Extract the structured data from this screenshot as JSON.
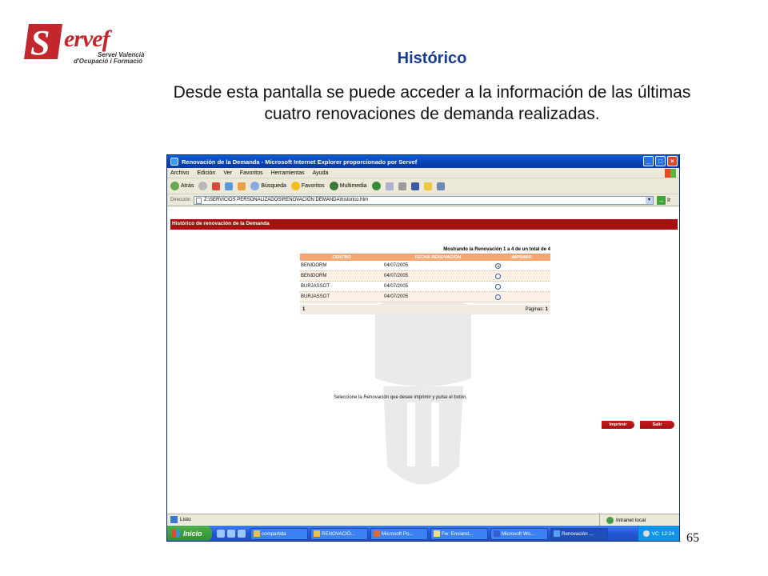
{
  "logo": {
    "name": "ervef",
    "line1": "Servei Valencià",
    "line2": "d'Ocupació i Formació"
  },
  "slide": {
    "title": "Histórico",
    "description": "Desde esta pantalla se puede acceder a la información de las últimas cuatro renovaciones de demanda realizadas.",
    "page_number": "65"
  },
  "window": {
    "title": "Renovación de la Demanda - Microsoft Internet Explorer proporcionado por Servef",
    "menu": [
      "Archivo",
      "Edición",
      "Ver",
      "Favoritos",
      "Herramientas",
      "Ayuda"
    ],
    "toolbar": {
      "back": "Atrás",
      "search": "Búsqueda",
      "favorites": "Favoritos",
      "multimedia": "Multimedia"
    },
    "address_label": "Dirección",
    "address_value": "Z:\\SERVICIOS PERSONALIZADOS\\RENOVACIÓN DEMANDA\\historico.htm",
    "go_label": "Ir"
  },
  "page": {
    "header": "Histórico de renovación de la Demanda",
    "table_caption": "Mostrando la Renovación 1 a 4 de un total de 4",
    "columns": [
      "CENTRO",
      "FECHA RENOVACIÓN",
      "IMPRIMIR"
    ],
    "rows": [
      {
        "centro": "BENIDORM",
        "fecha": "04/07/2005",
        "selected": true
      },
      {
        "centro": "BENIDORM",
        "fecha": "04/07/2005",
        "selected": false
      },
      {
        "centro": "BURJASSOT",
        "fecha": "04/07/2005",
        "selected": false
      },
      {
        "centro": "BURJASSOT",
        "fecha": "04/07/2005",
        "selected": false
      }
    ],
    "footer_left": "1",
    "pages_label": "Páginas:",
    "pages_value": "1",
    "instruction": "Seleccione la Renovación que desee imprimir y pulse el botón.",
    "print_button": "Imprimir",
    "exit_button": "Salir"
  },
  "status": {
    "text": "Listo",
    "zone": "Intranet local"
  },
  "taskbar": {
    "start": "Inicio",
    "items": [
      {
        "label": "compartida",
        "active": false
      },
      {
        "label": "RENOVACIÓ...",
        "active": false
      },
      {
        "label": "Microsoft Po...",
        "active": false
      },
      {
        "label": "Fw: Enviand...",
        "active": false
      },
      {
        "label": "Microsoft Wo...",
        "active": false
      },
      {
        "label": "Renovación ...",
        "active": true
      }
    ],
    "tray_lang": "VC",
    "clock": "12:24"
  }
}
